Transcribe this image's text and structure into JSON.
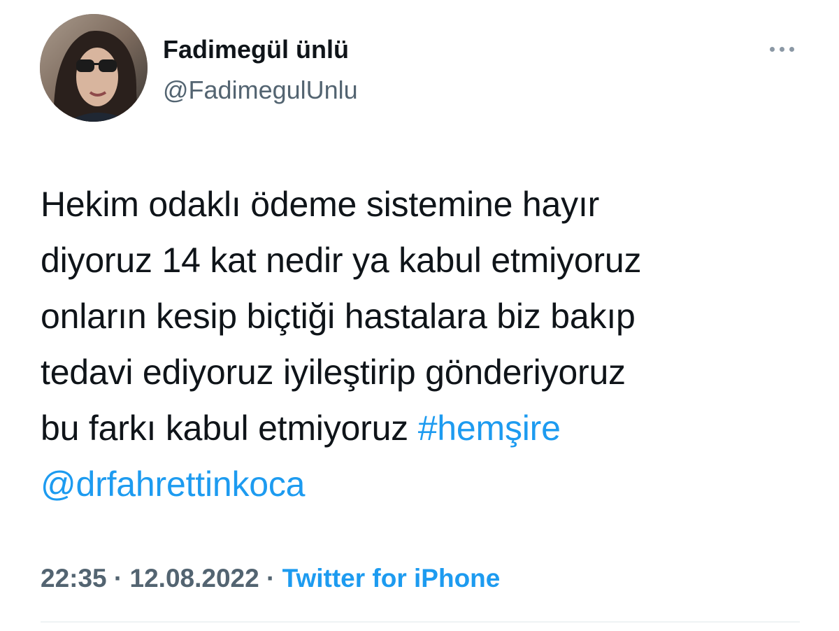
{
  "author": {
    "name": "Fadimegül ünlü",
    "handle": "@FadimegulUnlu"
  },
  "tweet": {
    "lines": [
      "Hekim odaklı ödeme sistemine hayır",
      "diyoruz 14 kat nedir ya kabul etmiyoruz",
      "onların kesip biçtiği hastalara biz bakıp",
      "tedavi ediyoruz iyileştirip gönderiyoruz",
      "bu farkı kabul etmiyoruz "
    ],
    "hashtag": "#hemşire",
    "mention": "@drfahrettinkoca"
  },
  "meta": {
    "time": "22:35",
    "separator": " · ",
    "date": "12.08.2022",
    "source": "Twitter for iPhone"
  },
  "icons": {
    "more": "more-horizontal-icon",
    "avatar": "profile-photo"
  },
  "colors": {
    "text": "#0f1419",
    "secondary": "#536471",
    "link": "#1d9bf0",
    "divider": "#eff3f4"
  }
}
